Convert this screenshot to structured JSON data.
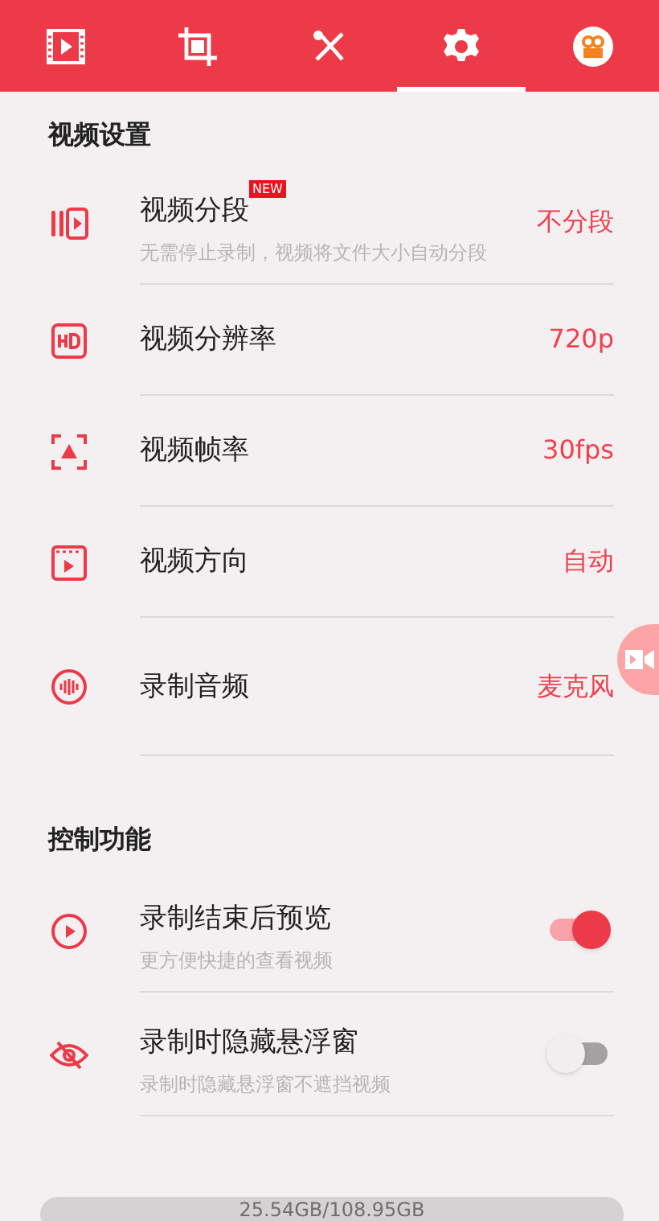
{
  "tabs": [
    {
      "selected": false
    },
    {
      "selected": false
    },
    {
      "selected": false
    },
    {
      "selected": true
    },
    {
      "selected": false
    }
  ],
  "sections": [
    {
      "title": "视频设置",
      "items": [
        {
          "kind": "value",
          "title": "视频分段",
          "badge": "NEW",
          "subtitle": "无需停止录制，视频将文件大小自动分段",
          "value": "不分段"
        },
        {
          "kind": "value",
          "title": "视频分辨率",
          "value": "720p"
        },
        {
          "kind": "value",
          "title": "视频帧率",
          "value": "30fps"
        },
        {
          "kind": "value",
          "title": "视频方向",
          "value": "自动"
        },
        {
          "kind": "value",
          "title": "录制音频",
          "value": "麦克风"
        }
      ]
    },
    {
      "title": "控制功能",
      "items": [
        {
          "kind": "toggle",
          "title": "录制结束后预览",
          "subtitle": "更方便快捷的查看视频",
          "on": true
        },
        {
          "kind": "toggle",
          "title": "录制时隐藏悬浮窗",
          "subtitle": "录制时隐藏悬浮窗不遮挡视频",
          "on": false
        }
      ]
    }
  ],
  "storage": {
    "text": "25.54GB/108.95GB"
  }
}
